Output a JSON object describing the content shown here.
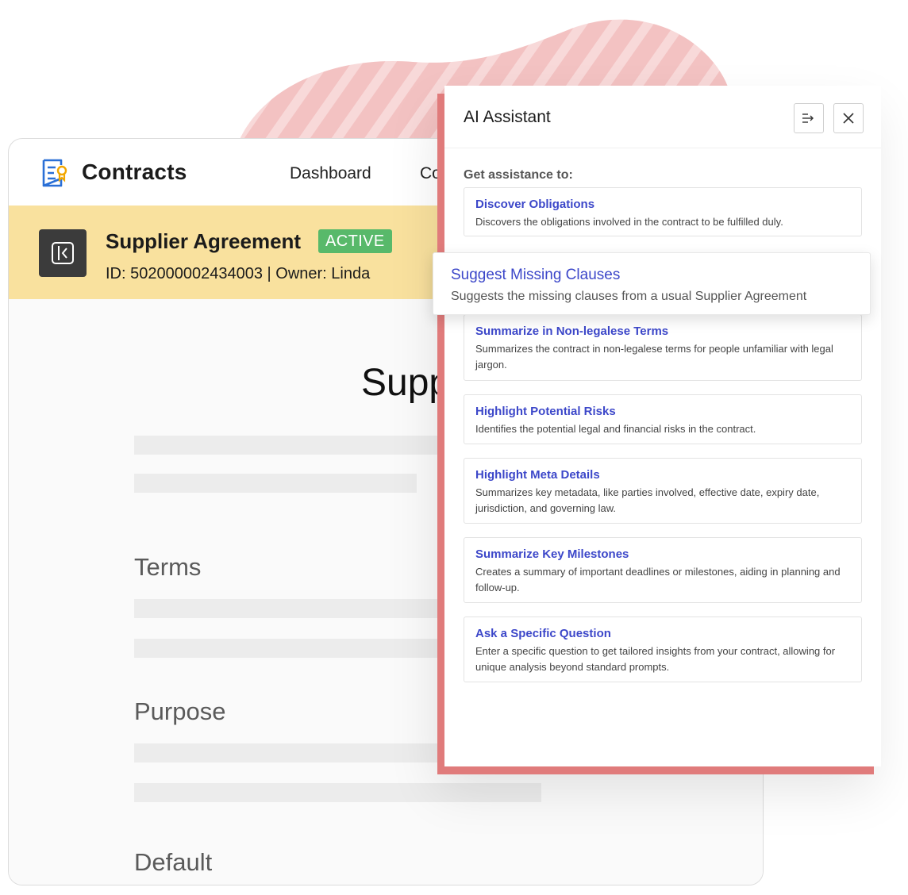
{
  "app": {
    "title": "Contracts",
    "nav": [
      "Dashboard",
      "Co"
    ]
  },
  "record": {
    "title": "Supplier Agreement",
    "status": "ACTIVE",
    "meta": "ID: 502000002434003 | Owner: Linda"
  },
  "document": {
    "title": "Supp",
    "sections": [
      "Terms",
      "Purpose",
      "Default"
    ]
  },
  "assistant": {
    "title": "AI Assistant",
    "subtitle": "Get assistance to:",
    "options": [
      {
        "title": "Discover Obligations",
        "desc": "Discovers the obligations involved in the contract to be fulfilled duly."
      },
      {
        "title": "Suggest Missing Clauses",
        "desc": "Suggests the missing clauses from a usual Supplier Agreement"
      },
      {
        "title": "Summarize in Non-legalese Terms",
        "desc": "Summarizes the contract in non-legalese terms for people unfamiliar with legal jargon."
      },
      {
        "title": "Highlight Potential Risks",
        "desc": "Identifies the potential legal and financial risks in the contract."
      },
      {
        "title": "Highlight Meta Details",
        "desc": "Summarizes key metadata, like parties involved, effective date, expiry date, jurisdiction, and governing law."
      },
      {
        "title": "Summarize Key Milestones",
        "desc": "Creates a summary of important deadlines or milestones, aiding in planning and follow-up."
      },
      {
        "title": "Ask a Specific Question",
        "desc": "Enter a specific question to get tailored insights from your contract, allowing for unique analysis beyond standard prompts."
      }
    ]
  },
  "colors": {
    "accent_link": "#3c47c9",
    "record_bar": "#f9e19e",
    "status_green": "#58b96a",
    "panel_edge": "#e07b7b",
    "blob_pink": "#f4c4c4"
  },
  "icons": [
    "contracts-logo-icon",
    "collapse-panel-icon",
    "expand-panel-icon",
    "close-icon"
  ]
}
